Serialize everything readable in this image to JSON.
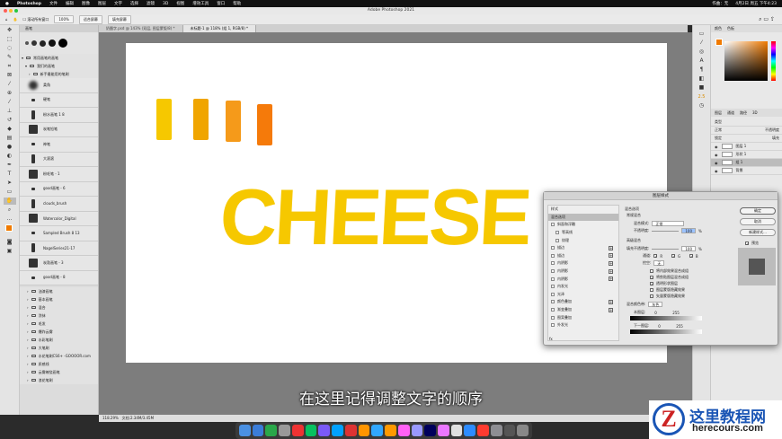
{
  "menubar": {
    "app": "Photoshop",
    "items": [
      "文件",
      "编辑",
      "图像",
      "图层",
      "文字",
      "选择",
      "滤镜",
      "3D",
      "视图",
      "增效工具",
      "窗口",
      "帮助"
    ],
    "status": "作曲：无",
    "clock": "4月2日 周五 下午4:23"
  },
  "window": {
    "title": "Adobe Photoshop 2021"
  },
  "options": {
    "scroll_all": "滚动所有窗口",
    "zoom": "100%",
    "fit": "适合屏幕",
    "fill": "填充屏幕"
  },
  "tabs": [
    "奶酪字.psd @ 143% (双层, 图层蒙版/8) *",
    "未标题-1 @ 118% (组 1, RGB/8) *"
  ],
  "brushes": {
    "panel_title": "画笔",
    "group": "常用画笔的画笔",
    "subgroup": "我们的画笔",
    "folder": "新手最能用的笔刷",
    "items": [
      "柔角",
      "硬笔",
      "粉水画笔 1 8",
      "炭笔铅笔",
      "神笔",
      "大滚滚",
      "粉毛笔 - 1",
      "good画笔 - 6",
      "clouds_brush",
      "Watercolor_Digital",
      "Sampled Brush 8 13",
      "NagelSeries21-17",
      "炭勃画笔 - 3",
      "good画笔 - 8"
    ],
    "folders": [
      "油漆画笔",
      "基本画笔",
      "混合",
      "涂抹",
      "毛发",
      "爆炸云雾",
      "水彩笔刷",
      "大笔刷",
      "水花笔刷CS6+ -GOOOOR.com",
      "质感线",
      "云雾缭绕画笔",
      "浪花笔刷"
    ]
  },
  "canvas": {
    "text": "CHEESE",
    "swatches": [
      "#f6c800",
      "#f0a500",
      "#f59a1a",
      "#f57a0a"
    ]
  },
  "colors": {
    "foreground": "#f07a00",
    "cheese": "#f6c800"
  },
  "right_panel": {
    "color_tab": "颜色",
    "swatch_tab": "色板",
    "layers_tabs": [
      "图层",
      "通道",
      "路径",
      "3D"
    ],
    "filter": "类型",
    "blend": "正常",
    "opacity_label": "不透明度",
    "lock_label": "锁定",
    "fill_label": "填充",
    "layers": [
      "图层 1",
      "形状 1",
      "组 1",
      "背景"
    ],
    "strip_value": "2.5"
  },
  "dialog": {
    "title": "图层样式",
    "list": [
      "样式",
      "混合选项",
      "斜面和浮雕",
      "等高线",
      "纹理",
      "描边",
      "描边",
      "内阴影",
      "内阴影",
      "内阴影",
      "内发光",
      "光泽",
      "颜色叠加",
      "渐变叠加",
      "图案叠加",
      "外发光"
    ],
    "section": "混合选项",
    "general": "常规混合",
    "blend_mode_label": "混合模式:",
    "blend_mode": "正常",
    "opacity_label": "不透明度:",
    "opacity": "100",
    "pct": "%",
    "advanced": "高级混合",
    "fill_opacity_label": "填充不透明度:",
    "fill_opacity": "100",
    "channels_label": "通道:",
    "r": "R",
    "g": "G",
    "b": "B",
    "knockout_label": "挖空:",
    "knockout": "无",
    "checks": [
      {
        "label": "将内部效果混合成组",
        "checked": false
      },
      {
        "label": "将剪贴图层混合成组",
        "checked": true
      },
      {
        "label": "透明形状图层",
        "checked": true
      },
      {
        "label": "图层蒙版隐藏效果",
        "checked": false
      },
      {
        "label": "矢量蒙版隐藏效果",
        "checked": false
      }
    ],
    "blend_if_label": "混合颜色带:",
    "blend_if": "灰色",
    "this_layer": "本图层:",
    "next_layer": "下一图层:",
    "min": "0",
    "max": "255",
    "ok": "确定",
    "cancel": "取消",
    "new_style": "新建样式...",
    "preview": "预览",
    "fx": "fx"
  },
  "status": {
    "zoom": "118.29%",
    "doc": "文档:2.34M/3.45M"
  },
  "subtitle": "在这里记得调整文字的顺序",
  "watermark": {
    "logo": "Z",
    "name": "这里教程网",
    "url": "herecours.com"
  }
}
